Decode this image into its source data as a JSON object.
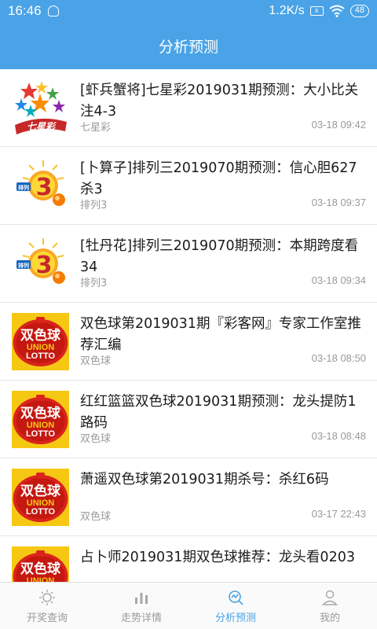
{
  "status_bar": {
    "time": "16:46",
    "network_speed": "1.2K/s",
    "sim_icon_text": "x",
    "battery": "48"
  },
  "header": {
    "title": "分析预测"
  },
  "articles": [
    {
      "title": "[虾兵蟹将]七星彩2019031期预测：大小比关注4-3",
      "category": "七星彩",
      "time": "03-18 09:42",
      "logo": "qixingcai-logo"
    },
    {
      "title": "[卜算子]排列三2019070期预测：信心胆627杀3",
      "category": "排列3",
      "time": "03-18 09:37",
      "logo": "pailie3-logo"
    },
    {
      "title": "[牡丹花]排列三2019070期预测：本期跨度看34",
      "category": "排列3",
      "time": "03-18 09:34",
      "logo": "pailie3-logo"
    },
    {
      "title": "双色球第2019031期『彩客网』专家工作室推荐汇编",
      "category": "双色球",
      "time": "03-18 08:50",
      "logo": "shuangseqiu-logo"
    },
    {
      "title": "红红篮篮双色球2019031期预测：龙头提防1路码",
      "category": "双色球",
      "time": "03-18 08:48",
      "logo": "shuangseqiu-logo"
    },
    {
      "title": "萧遥双色球第2019031期杀号：杀红6码",
      "category": "双色球",
      "time": "03-17 22:43",
      "logo": "shuangseqiu-logo"
    },
    {
      "title": "占卜师2019031期双色球推荐：龙头看0203",
      "category": "",
      "time": "",
      "logo": "shuangseqiu-logo"
    }
  ],
  "logo_text": {
    "qixingcai": "七星彩",
    "pailie": "排列",
    "three": "3",
    "ssq": "双色球",
    "union": "UNION",
    "lotto": "LOTTO"
  },
  "tabs": [
    {
      "label": "开奖查询",
      "icon": "sun-icon",
      "active": false
    },
    {
      "label": "走势详情",
      "icon": "bar-chart-icon",
      "active": false
    },
    {
      "label": "分析预测",
      "icon": "analysis-icon",
      "active": true
    },
    {
      "label": "我的",
      "icon": "user-icon",
      "active": false
    }
  ],
  "colors": {
    "primary": "#4aa3e6",
    "text": "#1b1b1b",
    "secondary": "#9a9a9a",
    "ssq_red": "#d9241c"
  }
}
